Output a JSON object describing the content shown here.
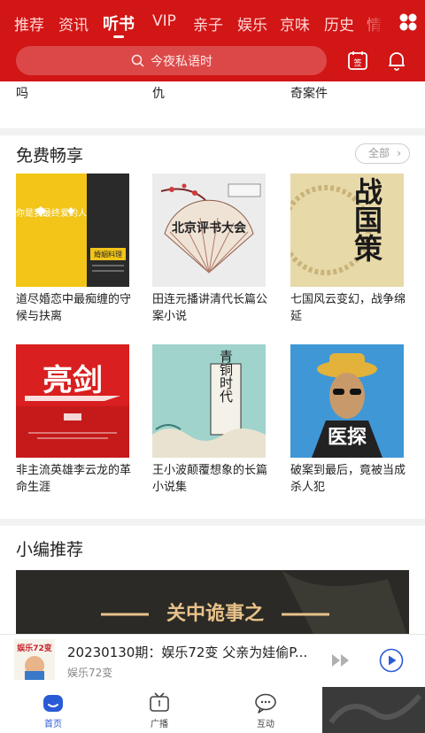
{
  "tabs": [
    "推荐",
    "资讯",
    "听书",
    "VIP",
    "亲子",
    "娱乐",
    "京味",
    "历史",
    "情"
  ],
  "active_tab": "听书",
  "search": {
    "placeholder": "今夜私语时"
  },
  "sign_icon_text": "签",
  "top_row": [
    {
      "title": "吗"
    },
    {
      "title": "仇"
    },
    {
      "title": "奇案件"
    }
  ],
  "free": {
    "title": "免费畅享",
    "all_label": "全部",
    "books": [
      {
        "title": "道尽婚恋中最痴缠的守\n候与扶离",
        "cover_text": "你是我最终爱的人",
        "cover_sub": "婚姻料理"
      },
      {
        "title": "田连元播讲清代长篇公\n案小说",
        "cover_text": "北京评书大会",
        "cover_sub": ""
      },
      {
        "title": "七国风云变幻，战争绵\n延",
        "cover_text": "战国策",
        "cover_sub": ""
      },
      {
        "title": "非主流英雄李云龙的革\n命生涯",
        "cover_text": "亮剑",
        "cover_sub": ""
      },
      {
        "title": "王小波颠覆想象的长篇\n小说集",
        "cover_text": "青铜时代",
        "cover_sub": ""
      },
      {
        "title": "破案到最后，竟被当成\n杀人犯",
        "cover_text": "医探",
        "cover_sub": ""
      }
    ]
  },
  "recommend": {
    "title": "小编推荐",
    "banner_text": "关中诡事之"
  },
  "player": {
    "cover_text": "娱乐72变",
    "title": "20230130期：娱乐72变 父亲为娃偷P...",
    "subtitle": "娱乐72变"
  },
  "nav": [
    {
      "label": "首页"
    },
    {
      "label": "广播"
    },
    {
      "label": "互动"
    }
  ],
  "colors": {
    "brand_red": "#d21515",
    "nav_active": "#2a5bd7"
  }
}
